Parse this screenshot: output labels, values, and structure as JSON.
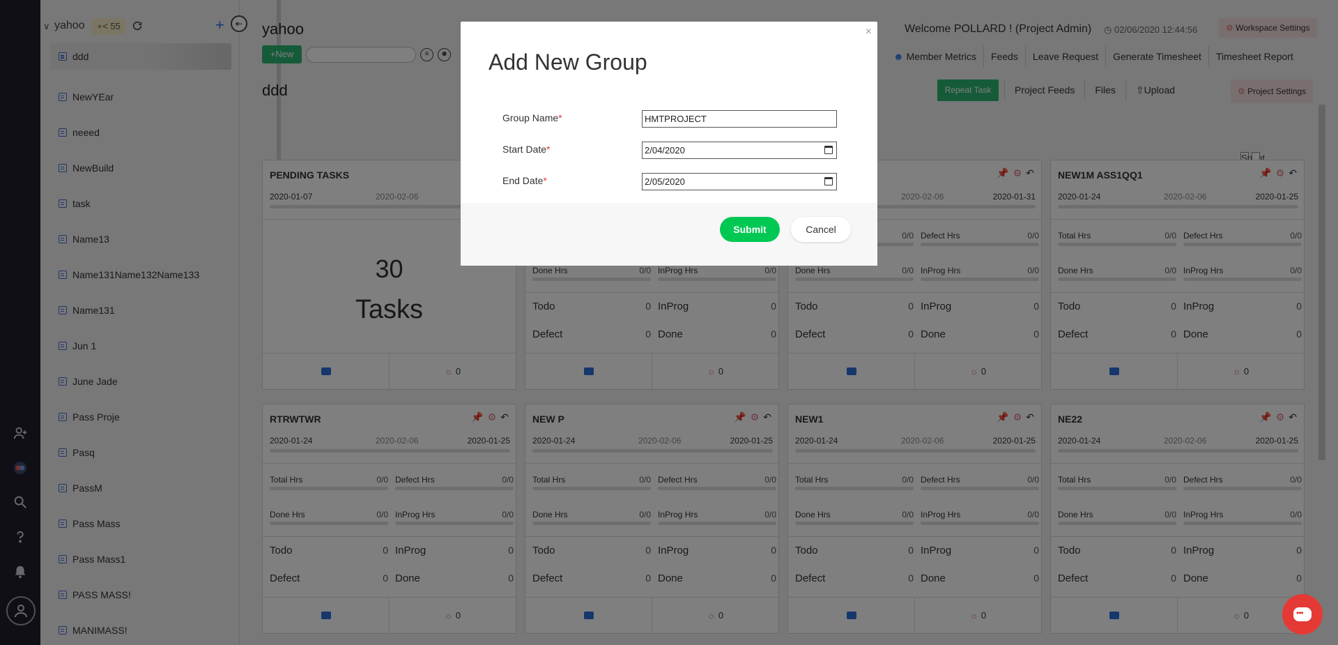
{
  "sidebar": {
    "workspace": "yahoo",
    "members_count": "55",
    "items": [
      {
        "label": "ddd"
      },
      {
        "label": "NewYEar"
      },
      {
        "label": "neeed"
      },
      {
        "label": "NewBuild"
      },
      {
        "label": "task"
      },
      {
        "label": "Name13"
      },
      {
        "label": "Name131Name132Name133"
      },
      {
        "label": "Name131"
      },
      {
        "label": "Jun 1"
      },
      {
        "label": "June Jade"
      },
      {
        "label": "Pass Proje"
      },
      {
        "label": "Pasq"
      },
      {
        "label": "PassM"
      },
      {
        "label": "Pass Mass"
      },
      {
        "label": "Pass Mass1"
      },
      {
        "label": "PASS MASS!"
      },
      {
        "label": "MANIMASS!"
      }
    ]
  },
  "header": {
    "title": "yahoo",
    "new_label": "New",
    "project_name": "ddd",
    "welcome": "Welcome POLLARD ! (Project Admin)",
    "datetime": "02/06/2020 12:44:56",
    "workspace_settings": "Workspace Settings",
    "nav": [
      "Member Metrics",
      "Feeds",
      "Leave Request",
      "Generate Timesheet",
      "Timesheet Report"
    ],
    "repeat_task": "Repeat Task",
    "subnav": [
      "Project Feeds",
      "Files",
      "Upload"
    ],
    "project_settings": "Project Settings",
    "sprint_list_view": "Sprint List View"
  },
  "pending": {
    "title": "PENDING TASKS",
    "start": "2020-01-07",
    "mid": "2020-02-06",
    "count": "30",
    "count_label": "Tasks",
    "bugs": "0"
  },
  "labels": {
    "total_hrs": "Total Hrs",
    "defect_hrs": "Defect Hrs",
    "done_hrs": "Done Hrs",
    "inprog_hrs": "InProg Hrs",
    "todo": "Todo",
    "inprog": "InProg",
    "defect": "Defect",
    "done": "Done"
  },
  "cards": [
    {
      "title": "",
      "start": "",
      "mid": "2020-02-06",
      "end": "2020-01-31",
      "total": "0/0",
      "defect_h": "0/0",
      "done_h": "0/0",
      "inprog_h": "0/0",
      "todo": "0",
      "inprog": "0",
      "defect": "0",
      "done": "0",
      "bugs": "0"
    },
    {
      "title": "",
      "start": "",
      "mid": "2020-02-06",
      "end": "2020-01-31",
      "total": "0/0",
      "defect_h": "0/0",
      "done_h": "0/0",
      "inprog_h": "0/0",
      "todo": "0",
      "inprog": "0",
      "defect": "0",
      "done": "0",
      "bugs": "0"
    },
    {
      "title": "NEW1M ASS1QQ1",
      "start": "2020-01-24",
      "mid": "2020-02-06",
      "end": "2020-01-25",
      "total": "0/0",
      "defect_h": "0/0",
      "done_h": "0/0",
      "inprog_h": "0/0",
      "todo": "0",
      "inprog": "0",
      "defect": "0",
      "done": "0",
      "bugs": "0"
    },
    {
      "title": "RTRWTWR",
      "start": "2020-01-24",
      "mid": "2020-02-06",
      "end": "2020-01-25",
      "total": "0/0",
      "defect_h": "0/0",
      "done_h": "0/0",
      "inprog_h": "0/0",
      "todo": "0",
      "inprog": "0",
      "defect": "0",
      "done": "0",
      "bugs": "0"
    },
    {
      "title": "NEW P",
      "start": "2020-01-24",
      "mid": "2020-02-06",
      "end": "2020-01-25",
      "total": "0/0",
      "defect_h": "0/0",
      "done_h": "0/0",
      "inprog_h": "0/0",
      "todo": "0",
      "inprog": "0",
      "defect": "0",
      "done": "0",
      "bugs": "0"
    },
    {
      "title": "NEW1",
      "start": "2020-01-24",
      "mid": "2020-02-06",
      "end": "2020-01-25",
      "total": "0/0",
      "defect_h": "0/0",
      "done_h": "0/0",
      "inprog_h": "0/0",
      "todo": "0",
      "inprog": "0",
      "defect": "0",
      "done": "0",
      "bugs": "0"
    },
    {
      "title": "NE22",
      "start": "2020-01-24",
      "mid": "2020-02-06",
      "end": "2020-01-25",
      "total": "0/0",
      "defect_h": "0/0",
      "done_h": "0/0",
      "inprog_h": "0/0",
      "todo": "0",
      "inprog": "0",
      "defect": "0",
      "done": "0",
      "bugs": "0"
    }
  ],
  "modal": {
    "title": "Add New Group",
    "close": "×",
    "group_name_label": "Group Name",
    "group_name_value": "HMTPROJECT",
    "start_date_label": "Start Date",
    "start_date_value": "2/04/2020",
    "end_date_label": "End Date",
    "end_date_value": "2/05/2020",
    "required_mark": "*",
    "submit": "Submit",
    "cancel": "Cancel"
  },
  "colors": {
    "accent_green": "#2bb673",
    "submit_green": "#00c853",
    "chat_red": "#e53935",
    "rail_dark": "#1e1f2b"
  }
}
